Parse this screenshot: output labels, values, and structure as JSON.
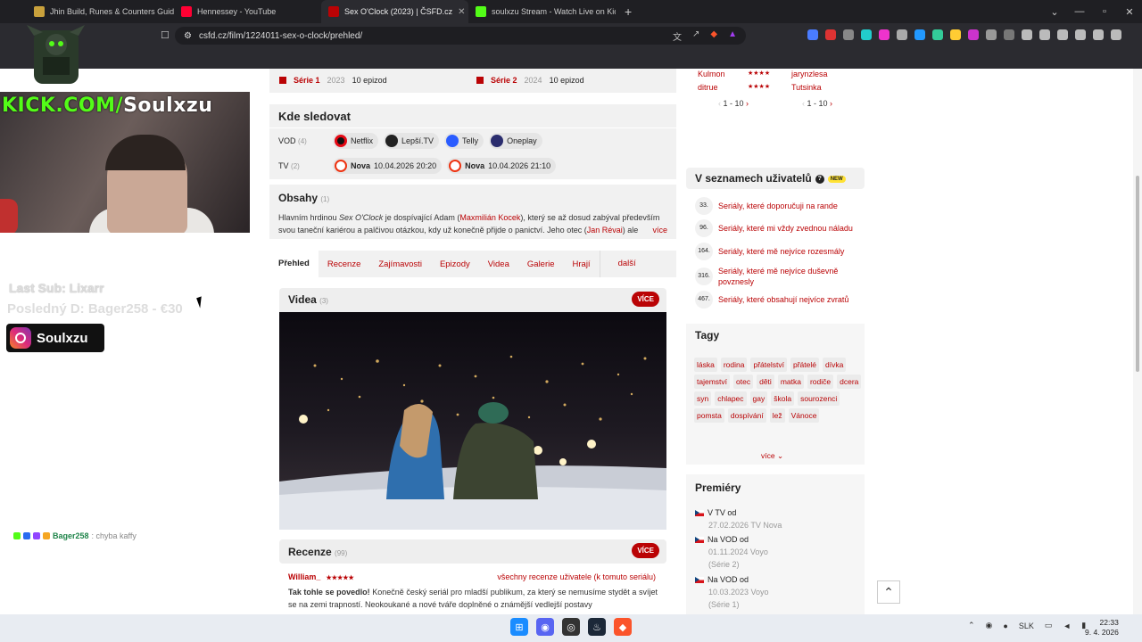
{
  "browser": {
    "tabs": [
      {
        "label": "Jhin Build, Runes & Counters Guide",
        "color": "#c9a13c"
      },
      {
        "label": "Hennessey - YouTube",
        "color": "#ff0033"
      },
      {
        "label": "Sex O'Clock (2023) | ČSFD.cz",
        "color": "#ba0305"
      },
      {
        "label": "soulxzu Stream - Watch Live on Kick",
        "color": "#53fc18"
      }
    ],
    "new_tab": "+",
    "url": "csfd.cz/film/1224011-sex-o-clock/prehled/"
  },
  "overlay": {
    "kick_prefix": "KICK.COM/",
    "kick_name": "Soulxzu",
    "last_sub": "Last Sub: Lixarr",
    "last_donation": "Posledný D: Bager258 - €30",
    "instagram": "Soulxzu",
    "chat_user": "Bager258",
    "chat_msg": ": chyba kaffy"
  },
  "series": [
    {
      "name": "Série 1",
      "year": "2023",
      "episodes": "10 epizod"
    },
    {
      "name": "Série 2",
      "year": "2024",
      "episodes": "10 epizod"
    }
  ],
  "kde": {
    "title": "Kde sledovat",
    "vod_label": "VOD",
    "vod_count": "(4)",
    "vod": [
      {
        "name": "Netflix",
        "color": "#e50914"
      },
      {
        "name": "Lepší.TV",
        "color": "#222222"
      },
      {
        "name": "Telly",
        "color": "#2a5cff"
      },
      {
        "name": "Oneplay",
        "color": "#2b2d6e"
      }
    ],
    "tv_label": "TV",
    "tv_count": "(2)",
    "tv": [
      {
        "name": "Nova",
        "time": "10.04.2026 20:20"
      },
      {
        "name": "Nova",
        "time": "10.04.2026 21:10"
      }
    ]
  },
  "obsah": {
    "title": "Obsahy",
    "count": "(1)",
    "text_a": "Hlavním hrdinou ",
    "text_italic": "Sex O'Clock",
    "text_b": " je dospívající Adam (",
    "actor1": "Maxmilián Kocek",
    "text_c": "), který se až dosud zabýval především svou taneční kariérou a palčivou otázkou, kdy už konečně přijde o panictví. Jeho otec (",
    "actor2": "Jan Révai",
    "text_d": ") ale",
    "more": "více"
  },
  "tabs": {
    "items": [
      "Přehled",
      "Recenze",
      "Zajímavosti",
      "Epizody",
      "Videa",
      "Galerie",
      "Hrají"
    ],
    "more": "další"
  },
  "videa": {
    "title": "Videa",
    "count": "(3)",
    "more": "VÍCE"
  },
  "recenze": {
    "title": "Recenze",
    "count": "(99)",
    "more": "VÍCE",
    "user": "William_",
    "stars": "★★★★★",
    "all_link": "všechny recenze uživatele (k tomuto seriálu)",
    "bold": "Tak tohle se povedlo!",
    "text": " Konečně český seriál pro mladší publikum, za který se nemusíme stydět a svíjet se na zemi trapností. Neokoukané a nové tváře doplněné o známější vedlejší postavy"
  },
  "ratings": [
    {
      "user": "Kulmon",
      "stars": "★★★★",
      "user2": "jarynzlesa"
    },
    {
      "user": "ditrue",
      "stars": "★★★★",
      "user2": "Tutsinka"
    }
  ],
  "pager": {
    "a": "1 - 10",
    "b": "1 - 10"
  },
  "seznam": {
    "title": "V seznamech uživatelů",
    "badge": "NEW",
    "items": [
      {
        "n": "33.",
        "t": "Seriály, které doporučuji na rande"
      },
      {
        "n": "96.",
        "t": "Seriály, které mi vždy zvednou náladu"
      },
      {
        "n": "164.",
        "t": "Seriály, které mě nejvíce rozesmály"
      },
      {
        "n": "316.",
        "t": "Seriály, které mě nejvíce duševně povznesly"
      },
      {
        "n": "467.",
        "t": "Seriály, které obsahují nejvíce zvratů"
      }
    ]
  },
  "tagy": {
    "title": "Tagy",
    "items": [
      "láska",
      "rodina",
      "přátelství",
      "přátelé",
      "dívka",
      "tajemství",
      "otec",
      "děti",
      "matka",
      "rodiče",
      "dcera",
      "syn",
      "chlapec",
      "gay",
      "škola",
      "sourozenci",
      "pomsta",
      "dospívání",
      "lež",
      "Vánoce"
    ],
    "more": "více"
  },
  "premiery": {
    "title": "Premiéry",
    "items": [
      {
        "label": "V TV od",
        "detail": "27.02.2026 TV Nova"
      },
      {
        "label": "Na VOD od",
        "detail": "01.11.2024 Voyo",
        "sub": "(Série 2)"
      },
      {
        "label": "Na VOD od",
        "detail": "10.03.2023 Voyo",
        "sub": "(Série 1)"
      }
    ]
  },
  "taskbar": {
    "lang": "SLK",
    "time": "22:33",
    "date": "9. 4. 2026"
  }
}
